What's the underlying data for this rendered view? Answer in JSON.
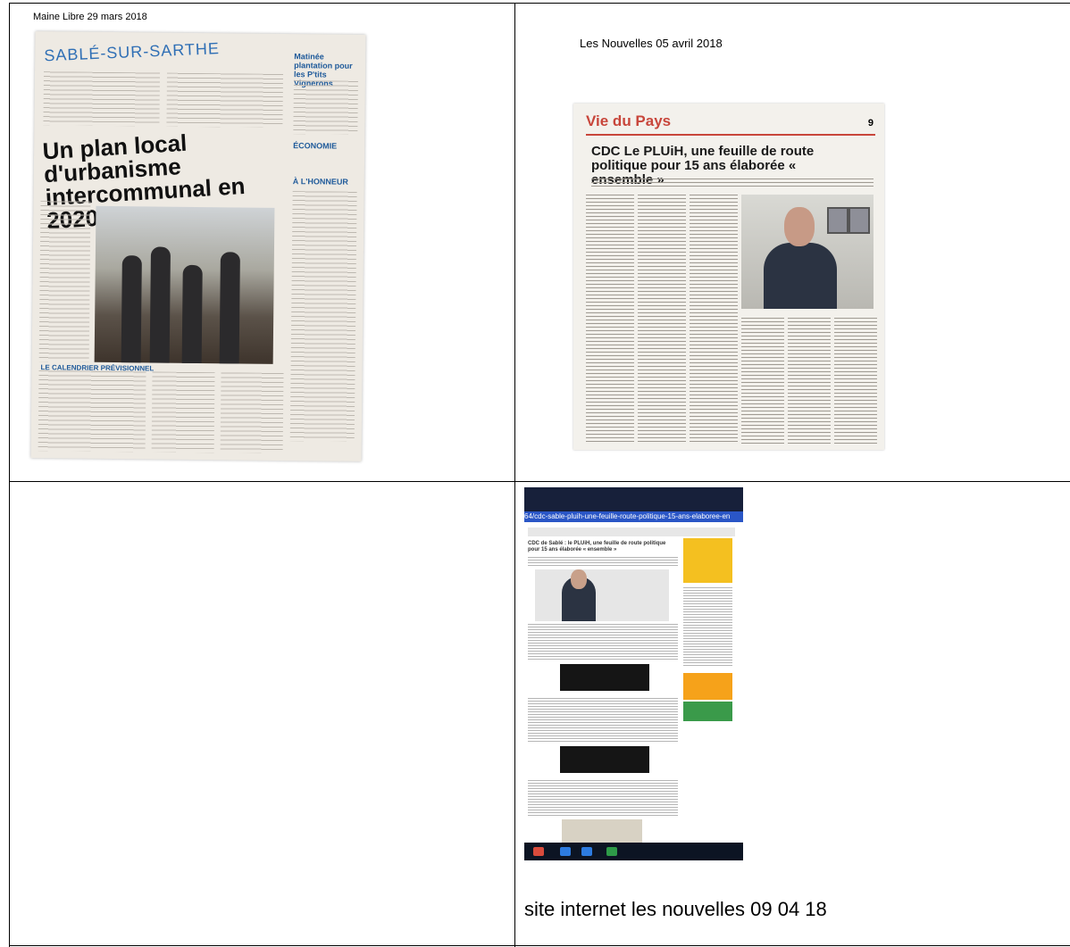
{
  "cells": {
    "top_left_caption": "Maine Libre 29 mars 2018",
    "top_right_caption": "Les Nouvelles 05 avril 2018",
    "bottom_right_caption": "site internet les nouvelles 09 04 18"
  },
  "clipping_maine_libre": {
    "masthead": "SABLÉ-SUR-SARTHE",
    "headline": "Un plan local d'urbanisme intercommunal en 2020",
    "side_titles": [
      "Matinée plantation pour les P'tits Vignerons",
      "ÉCONOMIE",
      "À L'HONNEUR",
      "LE CALENDRIER PRÉVISIONNEL"
    ]
  },
  "clipping_les_nouvelles": {
    "section": "Vie du Pays",
    "page_number": "9",
    "headline": "CDC Le PLUiH, une feuille de route politique pour 15 ans élaborée « ensemble »"
  },
  "website": {
    "url_bar": "64/cdc-sable-pluih-une-feuille-route-politique-15-ans-elaboree-en",
    "article_title": "CDC de Sablé : le PLUiH, une feuille de route politique pour 15 ans élaborée « ensemble »"
  }
}
